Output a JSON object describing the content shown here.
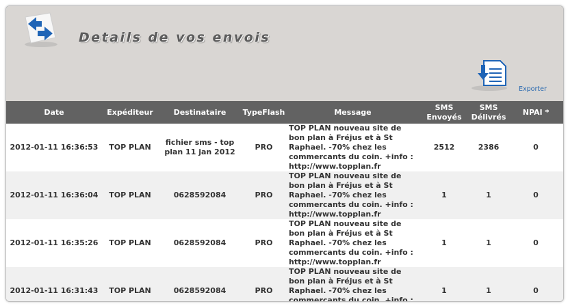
{
  "header": {
    "title": "Details de vos envois",
    "export_label": "Exporter",
    "back_icon": "back-arrows-icon",
    "export_icon": "document-download-icon"
  },
  "table": {
    "columns": [
      "Date",
      "Expéditeur",
      "Destinataire",
      "TypeFlash",
      "Message",
      "SMS Envoyés",
      "SMS Délivrés",
      "NPAI *"
    ],
    "rows": [
      {
        "date": "2012-01-11 16:36:53",
        "sender": "TOP PLAN",
        "recipient": "fichier sms - top plan 11 jan 2012",
        "type": "PRO",
        "message": "TOP PLAN nouveau site de bon plan à Fréjus et à St Raphael. -70% chez les commercants du coin. +info : http://www.topplan.fr",
        "sent": "2512",
        "delivered": "2386",
        "npai": "0"
      },
      {
        "date": "2012-01-11 16:36:04",
        "sender": "TOP PLAN",
        "recipient": "0628592084",
        "type": "PRO",
        "message": "TOP PLAN nouveau site de bon plan à Fréjus et à St Raphael. -70% chez les commercants du coin. +info : http://www.topplan.fr",
        "sent": "1",
        "delivered": "1",
        "npai": "0"
      },
      {
        "date": "2012-01-11 16:35:26",
        "sender": "TOP PLAN",
        "recipient": "0628592084",
        "type": "PRO",
        "message": "TOP PLAN nouveau site de bon plan à Fréjus et à St Raphael. -70% chez les commercants du coin. +info : http://www.topplan.fr",
        "sent": "1",
        "delivered": "1",
        "npai": "0"
      },
      {
        "date": "2012-01-11 16:31:43",
        "sender": "TOP PLAN",
        "recipient": "0628592084",
        "type": "PRO",
        "message": "TOP PLAN nouveau site de bon plan à Fréjus et à St Raphael. -70% chez les commercants du coin. +info : http://www.topplan.fr",
        "sent": "1",
        "delivered": "1",
        "npai": "0"
      }
    ]
  },
  "colors": {
    "header_bg": "#d9d6d3",
    "table_header_bg": "#626262",
    "link": "#2b6ab0",
    "icon_blue": "#1f64b6"
  }
}
